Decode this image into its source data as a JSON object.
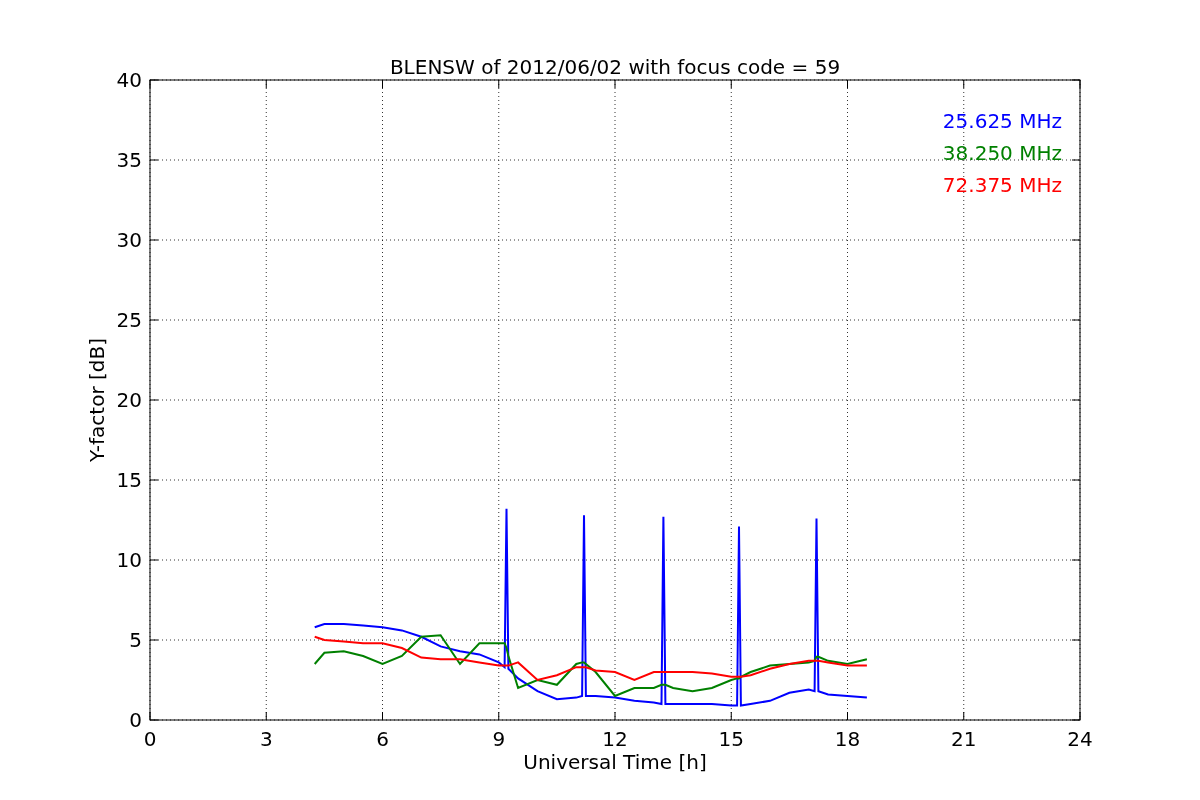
{
  "chart": {
    "chart_data": {
      "type": "line",
      "title": "BLENSW of 2012/06/02 with focus code = 59",
      "xlabel": "Universal Time [h]",
      "ylabel": "Y-factor [dB]",
      "x": [
        4.25,
        4.5,
        5,
        5.5,
        6,
        6.5,
        7,
        7.5,
        8,
        8.5,
        9,
        9.15,
        9.2,
        9.25,
        9.5,
        10,
        10.5,
        11,
        11.15,
        11.2,
        11.25,
        11.5,
        12,
        12.5,
        13,
        13.2,
        13.25,
        13.3,
        13.5,
        14,
        14.5,
        15,
        15.15,
        15.2,
        15.25,
        15.5,
        16,
        16.5,
        17,
        17.15,
        17.2,
        17.25,
        17.5,
        18,
        18.5
      ],
      "series": [
        {
          "name": "25.625 MHz",
          "color": "#0000ff",
          "values": [
            5.8,
            6.0,
            6.0,
            5.9,
            5.8,
            5.6,
            5.2,
            4.6,
            4.3,
            4.1,
            3.6,
            3.3,
            13.2,
            3.2,
            2.6,
            1.8,
            1.3,
            1.4,
            1.5,
            12.8,
            1.5,
            1.5,
            1.4,
            1.2,
            1.1,
            1.0,
            12.7,
            1.0,
            1.0,
            1.0,
            1.0,
            0.9,
            0.9,
            12.1,
            0.9,
            1.0,
            1.2,
            1.7,
            1.9,
            1.8,
            12.6,
            1.8,
            1.6,
            1.5,
            1.4
          ]
        },
        {
          "name": "38.250 MHz",
          "color": "#008000",
          "values": [
            3.5,
            4.2,
            4.3,
            4.0,
            3.5,
            4.0,
            5.2,
            5.3,
            3.5,
            4.8,
            4.8,
            4.8,
            4.5,
            4.0,
            2.0,
            2.5,
            2.2,
            3.5,
            3.6,
            3.6,
            3.5,
            3.0,
            1.5,
            2.0,
            2.0,
            2.2,
            2.2,
            2.2,
            2.0,
            1.8,
            2.0,
            2.5,
            2.6,
            2.6,
            2.7,
            3.0,
            3.4,
            3.5,
            3.6,
            3.7,
            3.95,
            3.95,
            3.7,
            3.5,
            3.8
          ]
        },
        {
          "name": "72.375 MHz",
          "color": "#ff0000",
          "values": [
            5.2,
            5.0,
            4.9,
            4.8,
            4.8,
            4.5,
            3.9,
            3.8,
            3.8,
            3.6,
            3.4,
            3.4,
            3.4,
            3.4,
            3.6,
            2.5,
            2.8,
            3.3,
            3.3,
            3.3,
            3.3,
            3.1,
            3.0,
            2.5,
            3.0,
            3.0,
            3.0,
            3.0,
            3.0,
            3.0,
            2.9,
            2.7,
            2.7,
            2.7,
            2.7,
            2.8,
            3.2,
            3.5,
            3.7,
            3.7,
            3.7,
            3.7,
            3.6,
            3.4,
            3.4
          ]
        }
      ],
      "grid": true,
      "xlim": [
        0,
        24
      ],
      "ylim": [
        0,
        40
      ],
      "xticks": [
        0,
        3,
        6,
        9,
        12,
        15,
        18,
        21,
        24
      ],
      "yticks": [
        0,
        5,
        10,
        15,
        20,
        25,
        30,
        35,
        40
      ]
    }
  }
}
